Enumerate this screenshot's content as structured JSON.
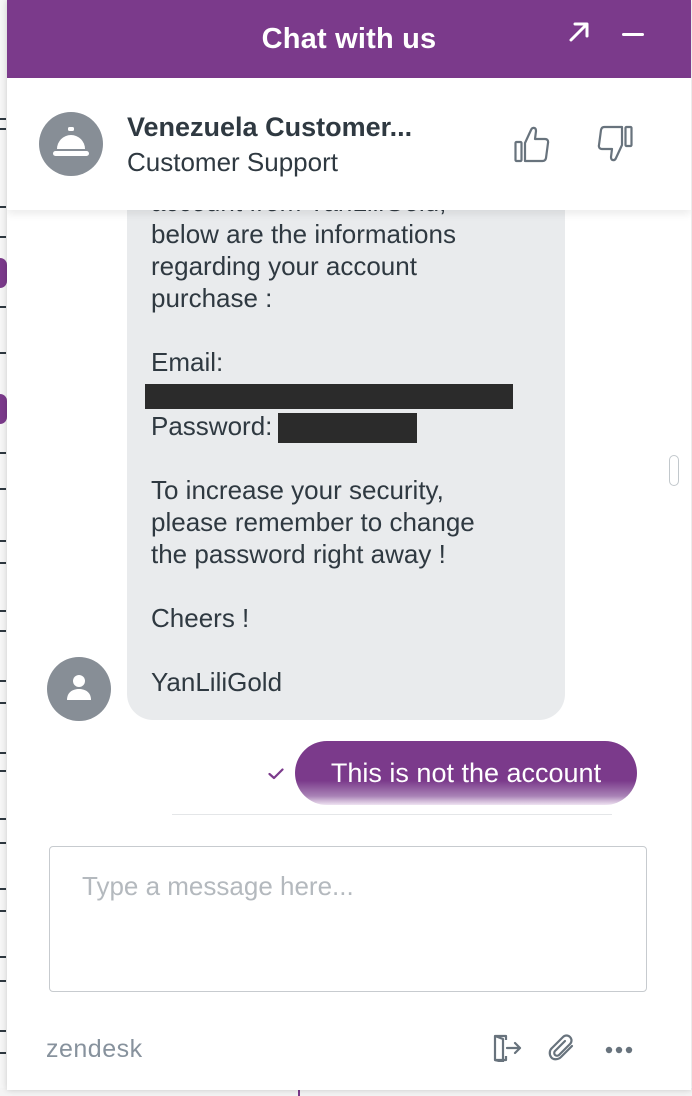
{
  "header": {
    "title": "Chat with us",
    "popout_icon": "arrow-up-right-icon",
    "minimize_icon": "minus-icon"
  },
  "agent": {
    "name": "Venezuela Customer...",
    "role": "Customer Support",
    "avatar_icon": "service-bell-icon",
    "thumbs_up_icon": "thumbs-up-icon",
    "thumbs_down_icon": "thumbs-down-icon"
  },
  "conversation": {
    "agent_message_lines": [
      "account from YanLiliGold,",
      "below are the informations",
      "regarding your account",
      "purchase :",
      "",
      "Email:",
      "",
      "Password:",
      "",
      "To increase your security,",
      "please remember to change",
      "the password right away !",
      "",
      "Cheers !",
      "",
      "YanLiliGold"
    ],
    "visitor_message": "This is not the account",
    "visitor_status_icon": "checkmark-icon",
    "agent_avatar_icon": "user-icon"
  },
  "composer": {
    "placeholder": "Type a message here...",
    "value": ""
  },
  "footer": {
    "brand": "zendesk",
    "end_chat_icon": "end-chat-icon",
    "attach_icon": "paperclip-icon",
    "more_icon": "ellipsis-icon"
  },
  "colors": {
    "brand": "#7b3a8b",
    "agent_bubble": "#e9ebed",
    "avatar": "#878e96",
    "text": "#2f3941"
  }
}
